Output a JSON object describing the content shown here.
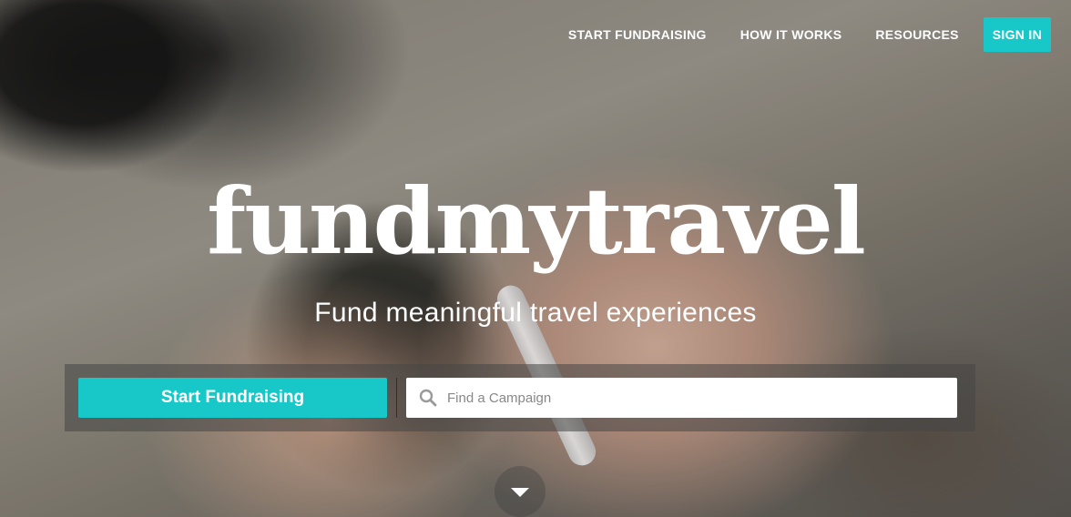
{
  "nav": {
    "items": [
      {
        "label": "START FUNDRAISING"
      },
      {
        "label": "HOW IT WORKS"
      },
      {
        "label": "RESOURCES"
      }
    ],
    "signin_label": "SIGN IN"
  },
  "hero": {
    "logo_text": "fundmytravel",
    "tagline": "Fund meaningful travel experiences"
  },
  "actions": {
    "start_button_label": "Start Fundraising",
    "search": {
      "placeholder": "Find a Campaign",
      "value": "",
      "icon": "search-icon"
    }
  },
  "scroll": {
    "icon": "chevron-down-icon"
  },
  "colors": {
    "accent": "#18c8c8",
    "text": "#ffffff"
  }
}
